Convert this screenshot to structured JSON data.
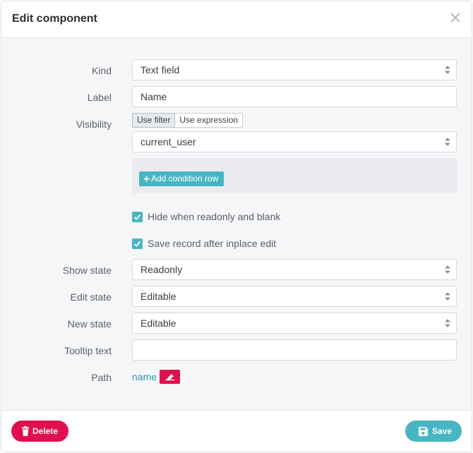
{
  "dialog": {
    "title": "Edit component"
  },
  "form": {
    "kind": {
      "label": "Kind",
      "value": "Text field"
    },
    "label": {
      "label": "Label",
      "value": "Name"
    },
    "visibility": {
      "label": "Visibility",
      "modes": [
        "Use filter",
        "Use expression"
      ],
      "active_mode": "Use filter",
      "value": "current_user",
      "add_condition_label": "Add condition row"
    },
    "hide_when_readonly": {
      "label": "Hide when readonly and blank",
      "checked": true
    },
    "save_after_edit": {
      "label": "Save record after inplace edit",
      "checked": true
    },
    "show_state": {
      "label": "Show state",
      "value": "Readonly"
    },
    "edit_state": {
      "label": "Edit state",
      "value": "Editable"
    },
    "new_state": {
      "label": "New state",
      "value": "Editable"
    },
    "tooltip": {
      "label": "Tooltip text",
      "value": ""
    },
    "path": {
      "label": "Path",
      "value": "name"
    }
  },
  "footer": {
    "delete_label": "Delete",
    "save_label": "Save"
  },
  "colors": {
    "accent": "#48b6c2",
    "danger": "#e0104e",
    "link": "#2d9aa9"
  },
  "icons": {
    "close": "close-icon",
    "select": "select-arrows-icon",
    "plus": "plus-icon",
    "check": "check-icon",
    "eraser": "eraser-icon",
    "trash": "trash-icon",
    "save": "floppy-disk-icon"
  }
}
